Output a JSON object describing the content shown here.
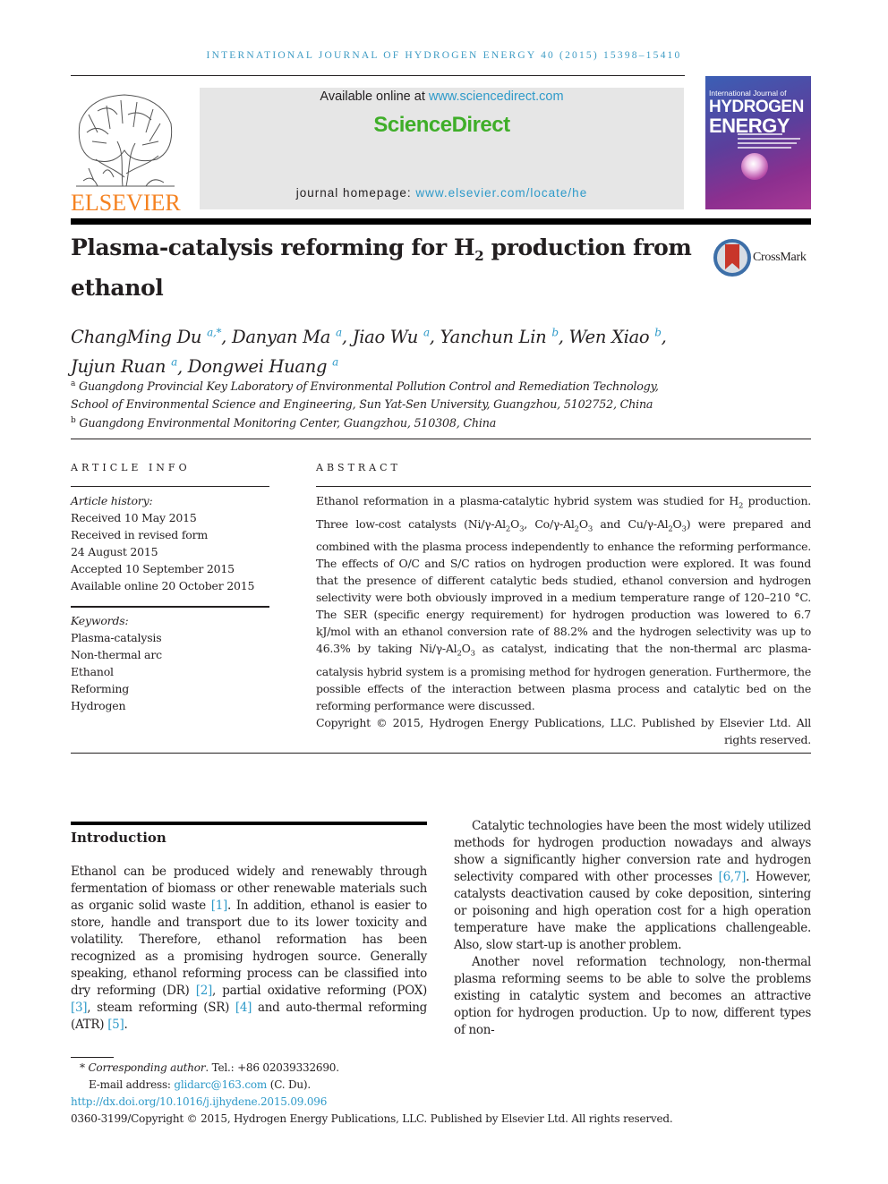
{
  "journal_header": {
    "running_head": "International Journal of Hydrogen Energy 40 (2015) 15398–15410"
  },
  "masthead": {
    "publisher_logo_text": "ELSEVIER",
    "available_online_prefix": "Available online at ",
    "available_online_link": "www.sciencedirect.com",
    "brand": "ScienceDirect",
    "homepage_prefix": "journal homepage: ",
    "homepage_link": "www.elsevier.com/locate/he",
    "cover": {
      "subtitle": "International Journal of",
      "title_line1": "HYDROGEN",
      "title_line2": "ENERGY"
    },
    "colors": {
      "elsevier_orange": "#f58220",
      "sciencedirect_green": "#3fae29",
      "link_blue": "#2e9ac9"
    }
  },
  "article": {
    "title_part1": "Plasma-catalysis reforming for H",
    "title_sub": "2",
    "title_part2": " production from ethanol",
    "crossmark_label": "CrossMark",
    "authors": [
      {
        "name": "ChangMing Du",
        "sup": "a,*",
        "sep": ", "
      },
      {
        "name": "Danyan Ma",
        "sup": "a",
        "sep": ", "
      },
      {
        "name": "Jiao Wu",
        "sup": "a",
        "sep": ", "
      },
      {
        "name": "Yanchun Lin",
        "sup": "b",
        "sep": ", "
      },
      {
        "name": "Wen Xiao",
        "sup": "b",
        "sep": ","
      },
      {
        "name": "Jujun Ruan",
        "sup": "a",
        "sep": ", "
      },
      {
        "name": "Dongwei Huang",
        "sup": "a",
        "sep": ""
      }
    ],
    "affiliations": [
      {
        "mark": "a",
        "text": "Guangdong Provincial Key Laboratory of Environmental Pollution Control and Remediation Technology, School of Environmental Science and Engineering, Sun Yat-Sen University, Guangzhou, 5102752, China"
      },
      {
        "mark": "b",
        "text": "Guangdong Environmental Monitoring Center, Guangzhou, 510308, China"
      }
    ]
  },
  "article_info": {
    "heading": "ARTICLE INFO",
    "history_label": "Article history:",
    "history": [
      "Received 10 May 2015",
      "Received in revised form",
      "24 August 2015",
      "Accepted 10 September 2015",
      "Available online 20 October 2015"
    ],
    "keywords_label": "Keywords:",
    "keywords": [
      "Plasma-catalysis",
      "Non-thermal arc",
      "Ethanol",
      "Reforming",
      "Hydrogen"
    ]
  },
  "abstract": {
    "heading": "ABSTRACT",
    "s1a": "Ethanol reformation in a plasma-catalytic hybrid system was studied for H",
    "s1b": " production. Three low-cost catalysts (Ni/γ-Al",
    "s1c": "O",
    "s1d": ", Co/γ-Al",
    "s1e": "O",
    "s1f": " and Cu/γ-Al",
    "s1g": "O",
    "s1h": ") were prepared and combined with the plasma process independently to enhance the reforming performance. The effects of O/C and S/C ratios on hydrogen production were explored. It was found that the presence of different catalytic beds studied, ethanol conversion and hydrogen selectivity were both obviously improved in a medium temperature range of 120–210 °C. The SER (specific energy requirement) for hydrogen production was lowered to 6.7 kJ/mol with an ethanol conversion rate of 88.2% and the hydrogen selectivity was up to 46.3% by taking Ni/γ-Al",
    "s1i": "O",
    "s1j": " as catalyst, indicating that the non-thermal arc plasma-catalysis hybrid system is a promising method for hydrogen generation. Furthermore, the possible effects of the interaction between plasma process and catalytic bed on the reforming performance were discussed.",
    "sub2": "2",
    "sub3": "3",
    "copyright": "Copyright © 2015, Hydrogen Energy Publications, LLC. Published by Elsevier Ltd. All rights reserved."
  },
  "introduction": {
    "heading": "Introduction",
    "p1_a": "Ethanol can be produced widely and renewably through fermentation of biomass or other renewable materials such as organic solid waste ",
    "ref1": "[1]",
    "p1_b": ". In addition, ethanol is easier to store, handle and transport due to its lower toxicity and volatility. Therefore, ethanol reformation has been recognized as a promising hydrogen source. Generally speaking, ethanol reforming process can be classified into dry reforming (DR) ",
    "ref2": "[2]",
    "p1_c": ", partial oxidative reforming (POX) ",
    "ref3": "[3]",
    "p1_d": ", steam reforming (SR) ",
    "ref4": "[4]",
    "p1_e": " and auto-thermal reforming (ATR) ",
    "ref5": "[5]",
    "p1_f": ".",
    "p2_a": "Catalytic technologies have been the most widely utilized methods for hydrogen production nowadays and always show a significantly higher conversion rate and hydrogen selectivity compared with other processes ",
    "ref67": "[6,7]",
    "p2_b": ". However, catalysts deactivation caused by coke deposition, sintering or poisoning and high operation cost for a high operation temperature have make the applications challengeable. Also, slow start-up is another problem.",
    "p3": "Another novel reformation technology, non-thermal plasma reforming seems to be able to solve the problems existing in catalytic system and becomes an attractive option for hydrogen production. Up to now, different types of non-"
  },
  "footnotes": {
    "corresponding_star": "*",
    "corresponding_label": "Corresponding author",
    "tel": ". Tel.: +86 02039332690.",
    "email_label": "E-mail address: ",
    "email": "glidarc@163.com",
    "email_suffix": " (C. Du).",
    "doi": "http://dx.doi.org/10.1016/j.ijhydene.2015.09.096",
    "issn_copyright": "0360-3199/Copyright © 2015, Hydrogen Energy Publications, LLC. Published by Elsevier Ltd. All rights reserved."
  }
}
